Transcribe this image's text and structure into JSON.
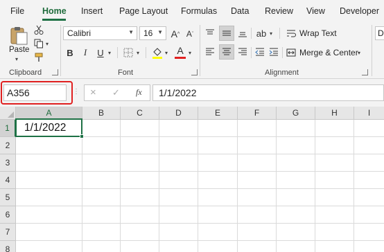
{
  "menu": {
    "tabs": [
      "File",
      "Home",
      "Insert",
      "Page Layout",
      "Formulas",
      "Data",
      "Review",
      "View",
      "Developer"
    ],
    "active_tab": "Home"
  },
  "ribbon": {
    "clipboard": {
      "label": "Clipboard",
      "paste_label": "Paste"
    },
    "font": {
      "label": "Font",
      "font_name": "Calibri",
      "font_size": "16",
      "increase_size": "A",
      "decrease_size": "A",
      "bold": "B",
      "italic": "I",
      "underline": "U",
      "font_color_glyph": "A",
      "font_color": "#e02020"
    },
    "alignment": {
      "label": "Alignment",
      "wrap_text": "Wrap Text",
      "merge_center": "Merge & Center"
    },
    "number_partial": "Da"
  },
  "formula_bar": {
    "name_box": "A356",
    "cancel_glyph": "×",
    "enter_glyph": "✓",
    "fx_label": "fx",
    "formula_value": "1/1/2022"
  },
  "sheet": {
    "columns": [
      "A",
      "B",
      "C",
      "D",
      "E",
      "F",
      "G",
      "H",
      "I"
    ],
    "rows": [
      "1",
      "2",
      "3",
      "4",
      "5",
      "6",
      "7",
      "8"
    ],
    "selected_cell_value": "1/1/2022",
    "accent_color": "#1e7145"
  }
}
